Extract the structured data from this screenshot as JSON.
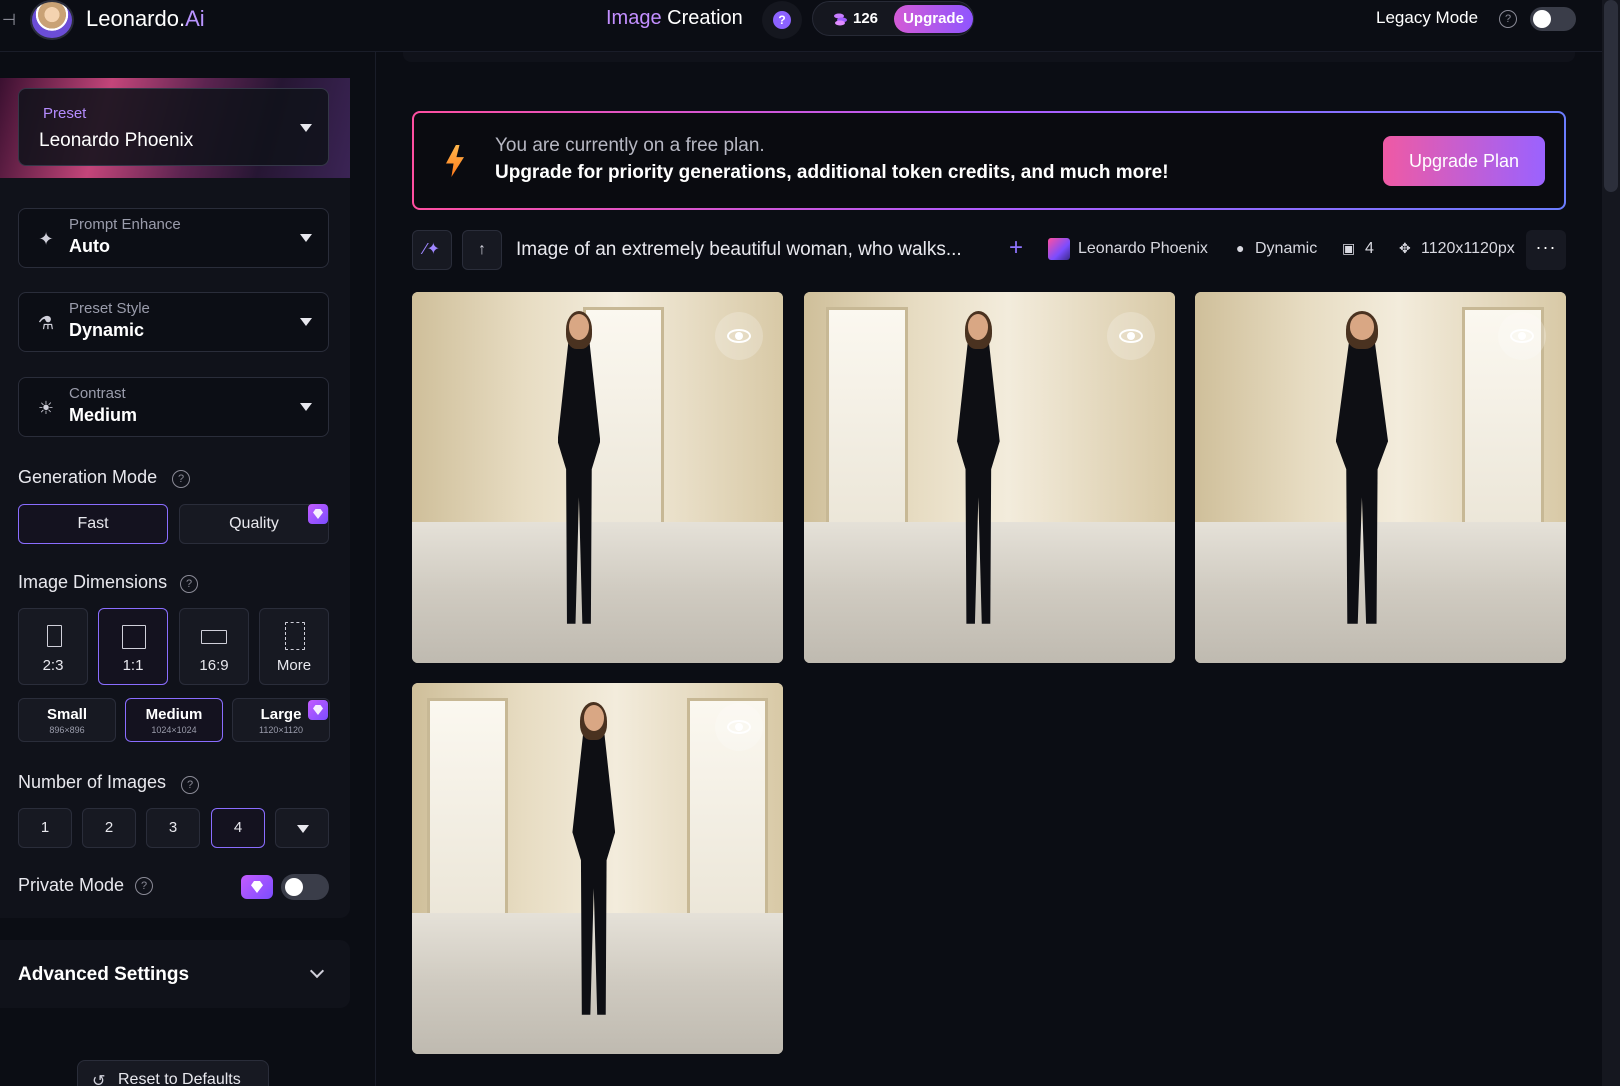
{
  "app": {
    "logo_main": "Leonardo.",
    "logo_accent": "Ai",
    "title_part1": "Image",
    "title_part2": "Creation",
    "help_glyph": "?",
    "token_count": "126",
    "upgrade_label": "Upgrade",
    "legacy_mode_label": "Legacy Mode",
    "legacy_mode_on": false
  },
  "sidebar": {
    "preset": {
      "label": "Preset",
      "value": "Leonardo Phoenix"
    },
    "prompt_enhance": {
      "label": "Prompt Enhance",
      "value": "Auto"
    },
    "preset_style": {
      "label": "Preset Style",
      "value": "Dynamic"
    },
    "contrast": {
      "label": "Contrast",
      "value": "Medium"
    },
    "generation_mode": {
      "title": "Generation Mode",
      "options": [
        "Fast",
        "Quality"
      ],
      "selected": "Fast"
    },
    "image_dimensions": {
      "title": "Image Dimensions",
      "ratios": [
        "2:3",
        "1:1",
        "16:9",
        "More"
      ],
      "selected_ratio": "1:1",
      "sizes": [
        {
          "label": "Small",
          "dims": "896×896"
        },
        {
          "label": "Medium",
          "dims": "1024×1024"
        },
        {
          "label": "Large",
          "dims": "1120×1120"
        }
      ],
      "selected_size": "Medium"
    },
    "number_of_images": {
      "title": "Number of Images",
      "options": [
        "1",
        "2",
        "3",
        "4"
      ],
      "selected": "4"
    },
    "private_mode": {
      "label": "Private Mode",
      "on": false
    },
    "advanced_settings_label": "Advanced Settings",
    "reset_label": "Reset to Defaults"
  },
  "banner": {
    "line1": "You are currently on a free plan.",
    "line2": "Upgrade for priority generations, additional token credits, and much more!",
    "button_label": "Upgrade Plan"
  },
  "generation": {
    "prompt": "Image of an extremely beautiful woman, who walks...",
    "model": "Leonardo Phoenix",
    "style": "Dynamic",
    "count": "4",
    "dimensions": "1120x1120px",
    "more_glyph": "···",
    "images": [
      {
        "alt": "woman in black suit walking in palace hall"
      },
      {
        "alt": "woman in black suit walking toward camera"
      },
      {
        "alt": "woman in black dress with slit walking"
      },
      {
        "alt": "woman in black suit walking by window"
      }
    ]
  },
  "colors": {
    "accent_purple": "#8a6dff",
    "upgrade_gradient_start": "#ef5aa4",
    "upgrade_gradient_end": "#9a62ff",
    "background": "#0b0d14"
  }
}
